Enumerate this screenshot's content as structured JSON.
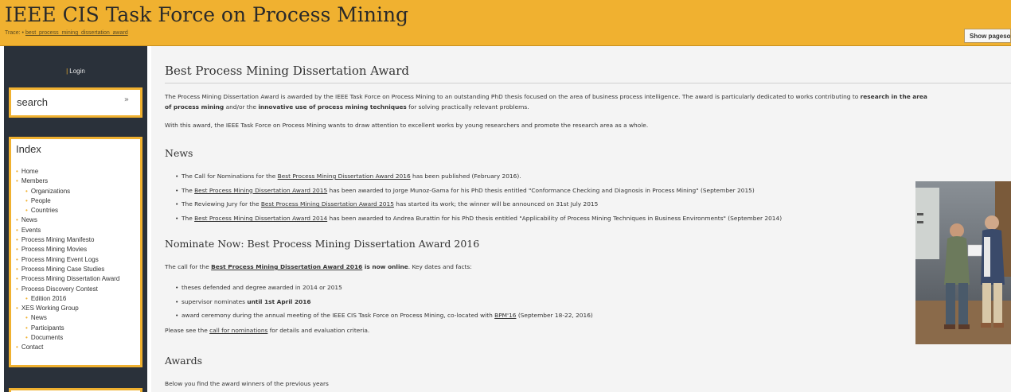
{
  "header": {
    "site_title": "IEEE CIS Task Force on Process Mining",
    "trace_label": "Trace:",
    "trace_bullet": "•",
    "trace_link": "best_process_mining_dissertation_award",
    "show_button": "Show pagesource"
  },
  "sidebar": {
    "login_sep": "|",
    "login": "Login",
    "search_label": "search",
    "search_button": "»",
    "index_title": "Index",
    "index_items": [
      {
        "label": "Home",
        "level": 1
      },
      {
        "label": "Members",
        "level": 1
      },
      {
        "label": "Organizations",
        "level": 2
      },
      {
        "label": "People",
        "level": 2
      },
      {
        "label": "Countries",
        "level": 2
      },
      {
        "label": "News",
        "level": 1
      },
      {
        "label": "Events",
        "level": 1
      },
      {
        "label": "Process Mining Manifesto",
        "level": 1
      },
      {
        "label": "Process Mining Movies",
        "level": 1
      },
      {
        "label": "Process Mining Event Logs",
        "level": 1
      },
      {
        "label": "Process Mining Case Studies",
        "level": 1
      },
      {
        "label": "Process Mining Dissertation Award",
        "level": 1
      },
      {
        "label": "Process Discovery Contest",
        "level": 1
      },
      {
        "label": "Edition 2016",
        "level": 2
      },
      {
        "label": "XES Working Group",
        "level": 1
      },
      {
        "label": "News",
        "level": 2
      },
      {
        "label": "Participants",
        "level": 2
      },
      {
        "label": "Documents",
        "level": 2
      },
      {
        "label": "Contact",
        "level": 1
      }
    ]
  },
  "main": {
    "title": "Best Process Mining Dissertation Award",
    "intro": {
      "p1a": "The Process Mining Dissertation Award is awarded by the IEEE Task Force on Process Mining to an outstanding PhD thesis focused on the area of business process intelligence. The award is particularly dedicated to works contributing to ",
      "p1b": "research in the area",
      "p1c": "of process mining",
      "p1d": " and/or the ",
      "p1e": "innovative use of process mining techniques",
      "p1f": " for solving practically relevant problems.",
      "p2": "With this award, the IEEE Task Force on Process Mining wants to draw attention to excellent works by young researchers and promote the research area as a whole."
    },
    "news_title": "News",
    "news": [
      {
        "pre": "The Call for Nominations for the ",
        "link": "Best Process Mining Dissertation Award 2016",
        "post": " has been published (February 2016)."
      },
      {
        "pre": "The ",
        "link": "Best Process Mining Dissertation Award 2015",
        "post": " has been awarded to Jorge Munoz-Gama for his PhD thesis entitled \"Conformance Checking and Diagnosis in Process Mining\" (September 2015)"
      },
      {
        "pre": "The Reviewing Jury for the ",
        "link": "Best Process Mining Dissertation Award 2015",
        "post": " has started its work; the winner will be announced on 31st July 2015"
      },
      {
        "pre": "The ",
        "link": "Best Process Mining Dissertation Award 2014",
        "post": " has been awarded to Andrea Burattin for his PhD thesis entitled \"Applicability of Process Mining Techniques in Business Environments\" (September 2014)"
      }
    ],
    "nominate_title": "Nominate Now: Best Process Mining Dissertation Award 2016",
    "call": {
      "pre": "The call for the ",
      "link": "Best Process Mining Dissertation Award 2016",
      "bold": " is now online",
      "post": ". Key dates and facts:"
    },
    "facts": {
      "f1": "theses defended and degree awarded in 2014 or 2015",
      "f2_pre": "supervisor nominates ",
      "f2_bold": "until 1st April 2016",
      "f3_pre": "award ceremony during the annual meeting of the IEEE CIS Task Force on Process Mining, co-located with ",
      "f3_link": "BPM'16",
      "f3_post": " (September 18-22, 2016)"
    },
    "see": {
      "pre": "Please see the ",
      "link": "call for nominations",
      "post": " for details and evaluation criteria."
    },
    "awards_title": "Awards",
    "awards_text": "Below you find the award winners of the previous years"
  }
}
